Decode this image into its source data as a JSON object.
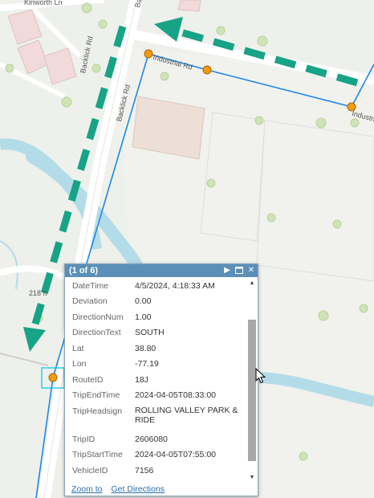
{
  "map": {
    "streets": {
      "kinworth": "Kinworth Ln",
      "backlick_upper": "Backlick Rd",
      "backlick_lower": "Backlick Rd",
      "backlick_bottom": "Backlick",
      "industrial_a": "Industrial Rd",
      "industrial_b": "Industrial",
      "route_shield": "218 ft"
    }
  },
  "popup": {
    "count": "(1 of 6)",
    "fields": [
      {
        "key": "DateTime",
        "value": "4/5/2024, 4:18:33 AM"
      },
      {
        "key": "Deviation",
        "value": "0.00"
      },
      {
        "key": "DirectionNum",
        "value": "1.00"
      },
      {
        "key": "DirectionText",
        "value": "SOUTH"
      },
      {
        "key": "Lat",
        "value": "38.80"
      },
      {
        "key": "Lon",
        "value": "-77.19"
      },
      {
        "key": "RouteID",
        "value": "18J"
      },
      {
        "key": "TripEndTime",
        "value": "2024-04-05T08:33:00"
      },
      {
        "key": "TripHeadsign",
        "value": "ROLLING VALLEY PARK & RIDE"
      },
      {
        "key": "TripID",
        "value": "2606080"
      },
      {
        "key": "TripStartTime",
        "value": "2024-04-05T07:55:00"
      },
      {
        "key": "VehicleID",
        "value": "7156"
      }
    ],
    "footer": {
      "zoom_to": "Zoom to",
      "get_directions": "Get Directions"
    }
  },
  "colors": {
    "route_line": "#1e88e5",
    "stop_marker": "#f39c12",
    "direction_arrow": "#17a386",
    "popup_header": "#5b8fb8"
  }
}
